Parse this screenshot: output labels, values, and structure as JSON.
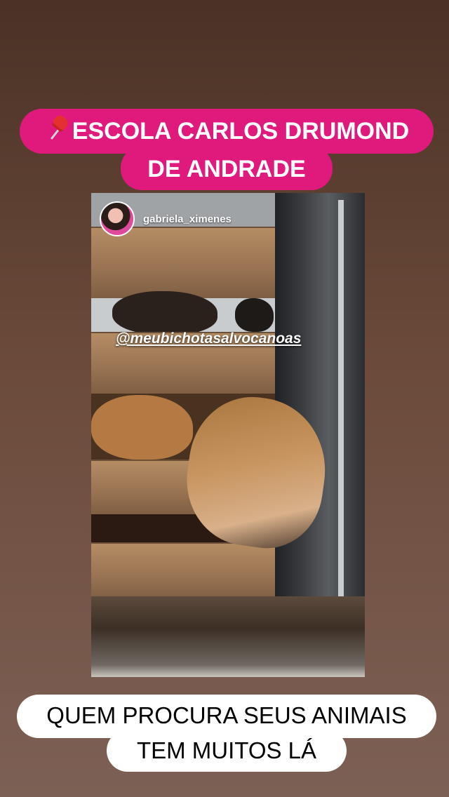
{
  "caption_top": {
    "pin_icon": "pushpin-icon",
    "line1": "ESCOLA CARLOS DRUMOND",
    "line2": "DE ANDRADE",
    "color": "#e0197d"
  },
  "reposted_story": {
    "username": "gabriela_ximenes",
    "mention": "@meubichotasalvocanoas"
  },
  "caption_bottom": {
    "line1": "QUEM PROCURA SEUS ANIMAIS",
    "line2": "TEM MUITOS LÁ"
  }
}
